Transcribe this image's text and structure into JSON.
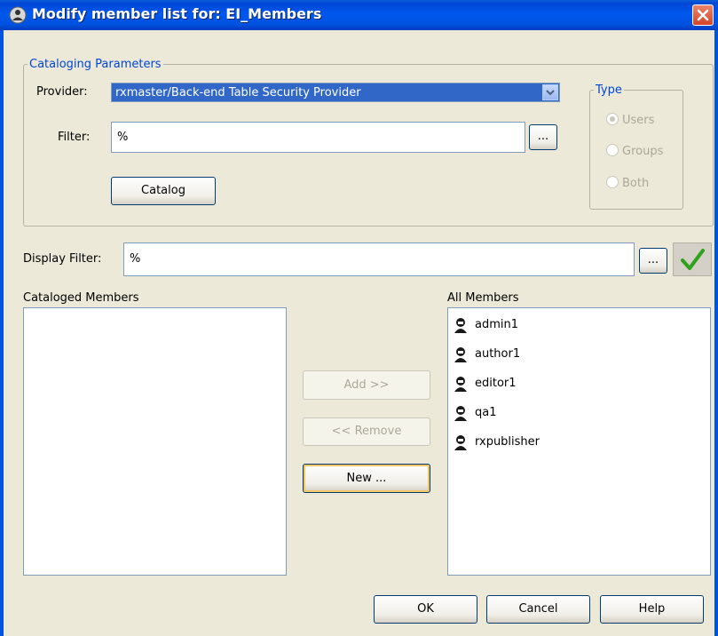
{
  "window": {
    "title": "Modify member list for: EI_Members"
  },
  "cataloging": {
    "legend": "Cataloging Parameters",
    "provider_label": "Provider:",
    "provider_value": "rxmaster/Back-end Table Security Provider",
    "filter_label": "Filter:",
    "filter_value": "%",
    "browse_label": "...",
    "catalog_button": "Catalog"
  },
  "type_group": {
    "legend": "Type",
    "options": [
      {
        "label": "Users",
        "checked": true
      },
      {
        "label": "Groups",
        "checked": false
      },
      {
        "label": "Both",
        "checked": false
      }
    ]
  },
  "display_filter": {
    "label": "Display Filter:",
    "value": "%",
    "browse_label": "..."
  },
  "cataloged_members": {
    "label": "Cataloged Members",
    "items": []
  },
  "all_members": {
    "label": "All Members",
    "items": [
      "admin1",
      "author1",
      "editor1",
      "qa1",
      "rxpublisher"
    ]
  },
  "actions": {
    "add": "Add >>",
    "remove": "<< Remove",
    "new": "New ..."
  },
  "footer": {
    "ok": "OK",
    "cancel": "Cancel",
    "help": "Help"
  },
  "colors": {
    "title_bar": "#0052e0",
    "accent_check": "#2ea21b",
    "dialog_bg": "#ece9d8"
  }
}
